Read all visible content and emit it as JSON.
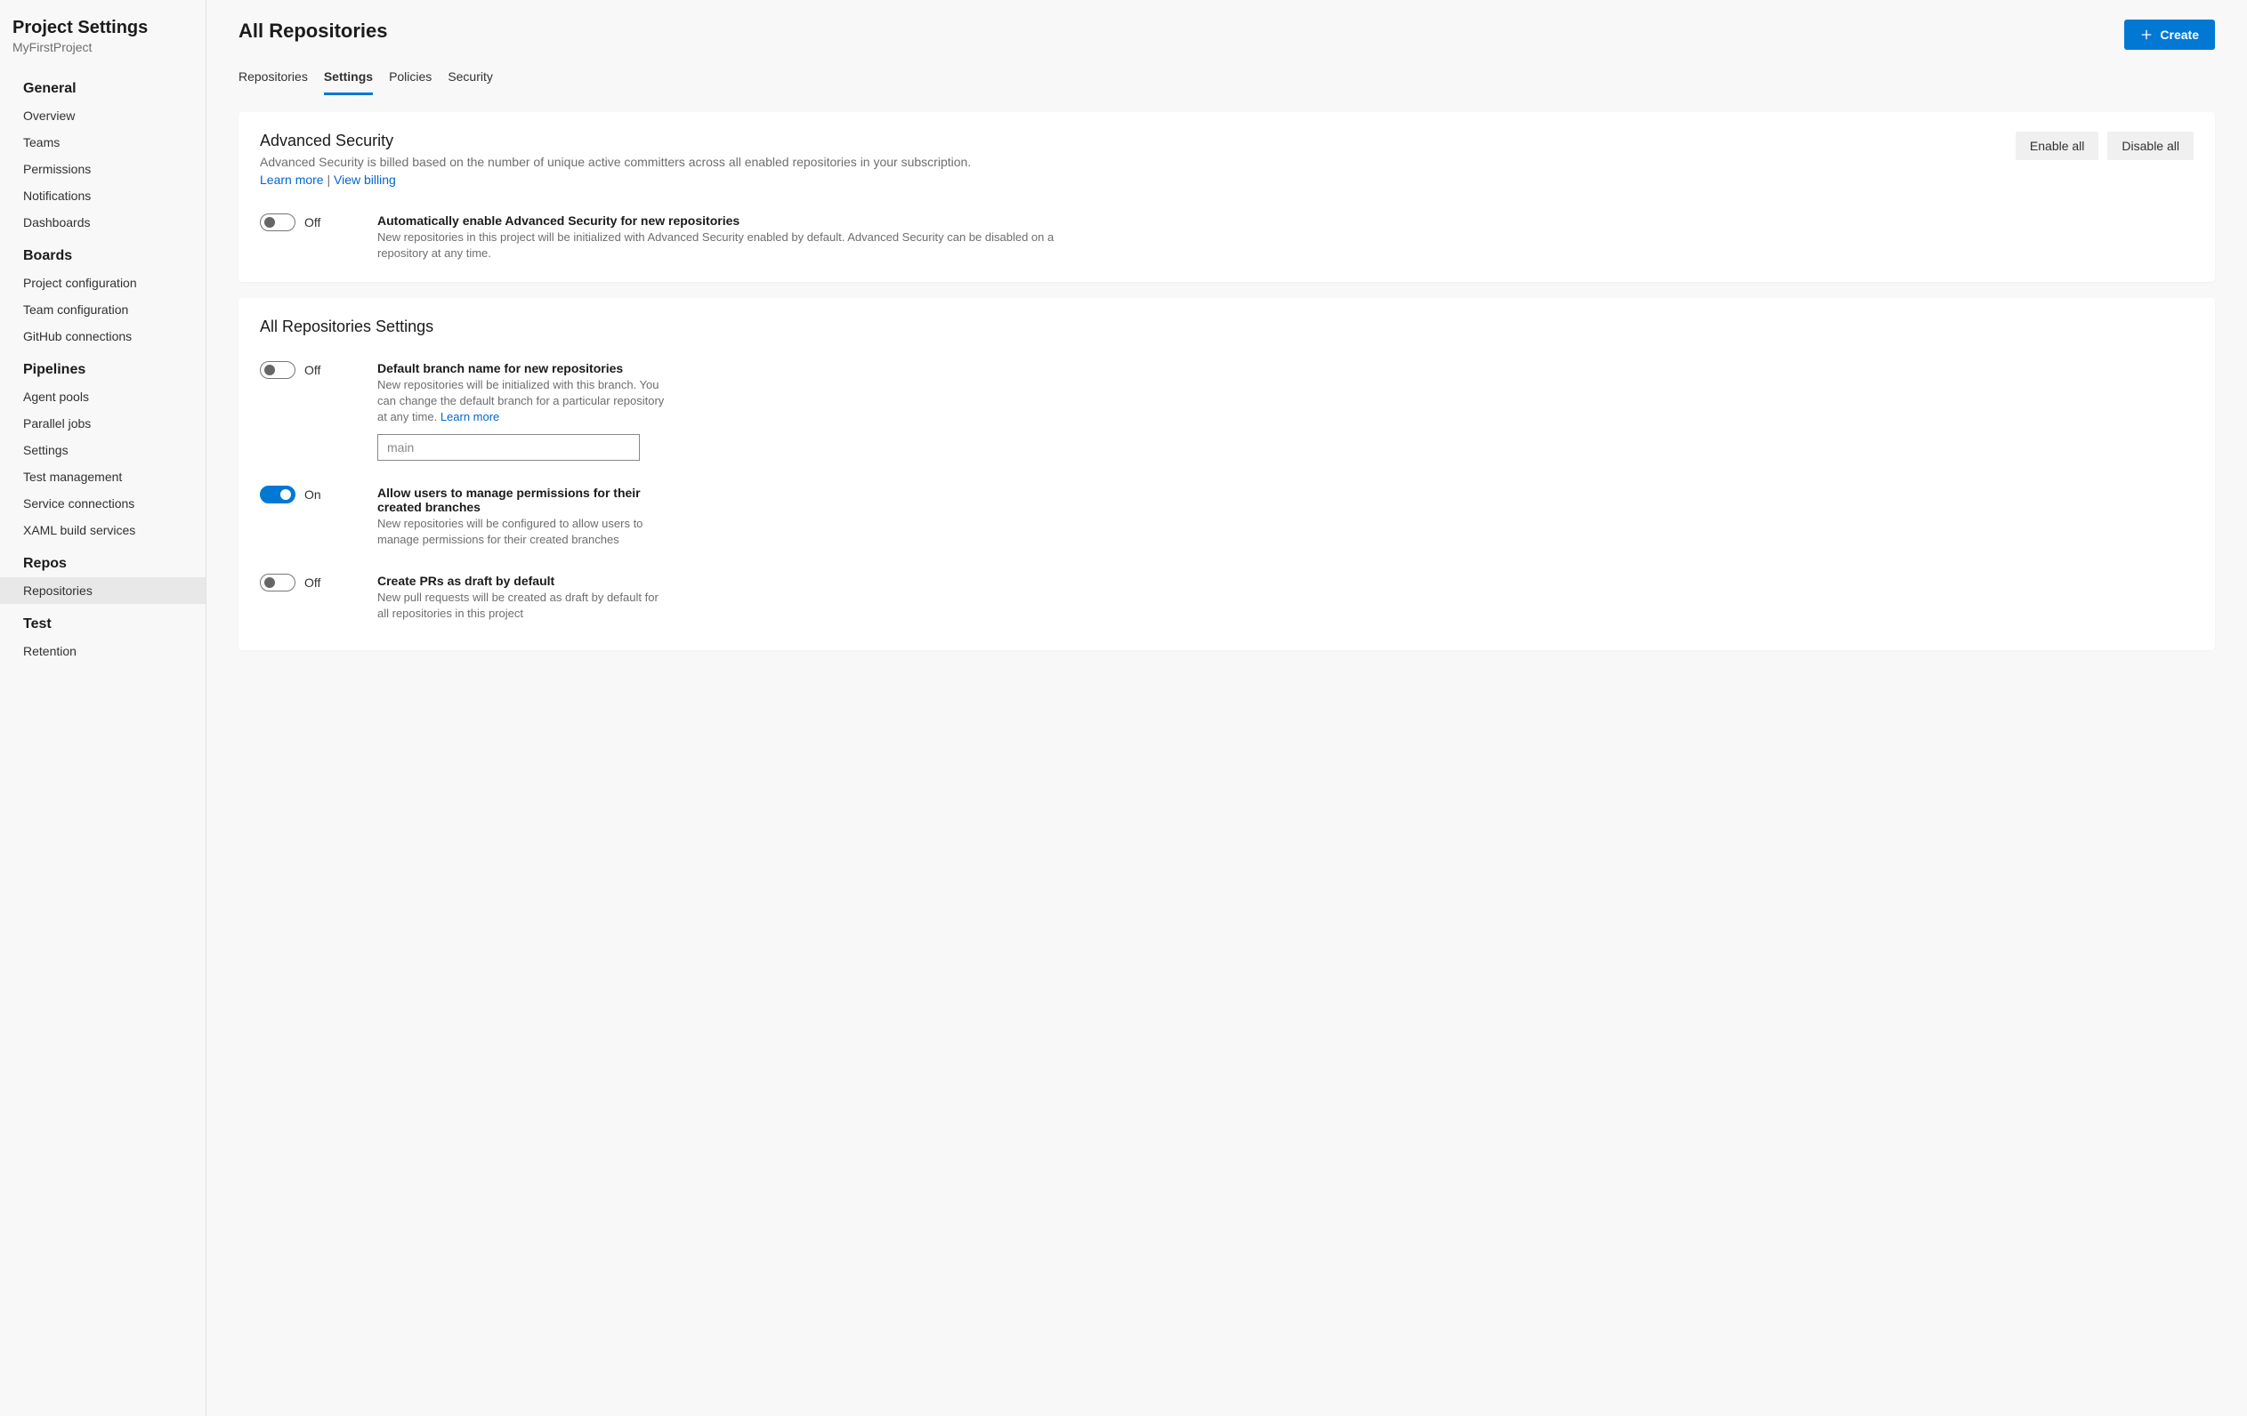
{
  "sidebar": {
    "title": "Project Settings",
    "project": "MyFirstProject",
    "sections": [
      {
        "title": "General",
        "items": [
          "Overview",
          "Teams",
          "Permissions",
          "Notifications",
          "Dashboards"
        ]
      },
      {
        "title": "Boards",
        "items": [
          "Project configuration",
          "Team configuration",
          "GitHub connections"
        ]
      },
      {
        "title": "Pipelines",
        "items": [
          "Agent pools",
          "Parallel jobs",
          "Settings",
          "Test management",
          "Service connections",
          "XAML build services"
        ]
      },
      {
        "title": "Repos",
        "items": [
          "Repositories"
        ]
      },
      {
        "title": "Test",
        "items": [
          "Retention"
        ]
      }
    ],
    "active": "Repositories"
  },
  "page": {
    "title": "All Repositories",
    "create_label": "Create",
    "tabs": [
      "Repositories",
      "Settings",
      "Policies",
      "Security"
    ],
    "active_tab": "Settings"
  },
  "advanced_security": {
    "title": "Advanced Security",
    "desc": "Advanced Security is billed based on the number of unique active committers across all enabled repositories in your subscription.",
    "learn_more": "Learn more",
    "sep": " | ",
    "view_billing": "View billing",
    "enable_all": "Enable all",
    "disable_all": "Disable all",
    "auto_enable": {
      "state": "off",
      "state_label": "Off",
      "title": "Automatically enable Advanced Security for new repositories",
      "desc": "New repositories in this project will be initialized with Advanced Security enabled by default. Advanced Security can be disabled on a repository at any time."
    }
  },
  "repo_settings": {
    "title": "All Repositories Settings",
    "default_branch": {
      "state": "off",
      "state_label": "Off",
      "title": "Default branch name for new repositories",
      "desc": "New repositories will be initialized with this branch. You can change the default branch for a particular repository at any time. ",
      "learn_more": "Learn more",
      "input_value": "main"
    },
    "manage_perms": {
      "state": "on",
      "state_label": "On",
      "title": "Allow users to manage permissions for their created branches",
      "desc": "New repositories will be configured to allow users to manage permissions for their created branches"
    },
    "draft_pr": {
      "state": "off",
      "state_label": "Off",
      "title": "Create PRs as draft by default",
      "desc": "New pull requests will be created as draft by default for all repositories in this project"
    }
  }
}
